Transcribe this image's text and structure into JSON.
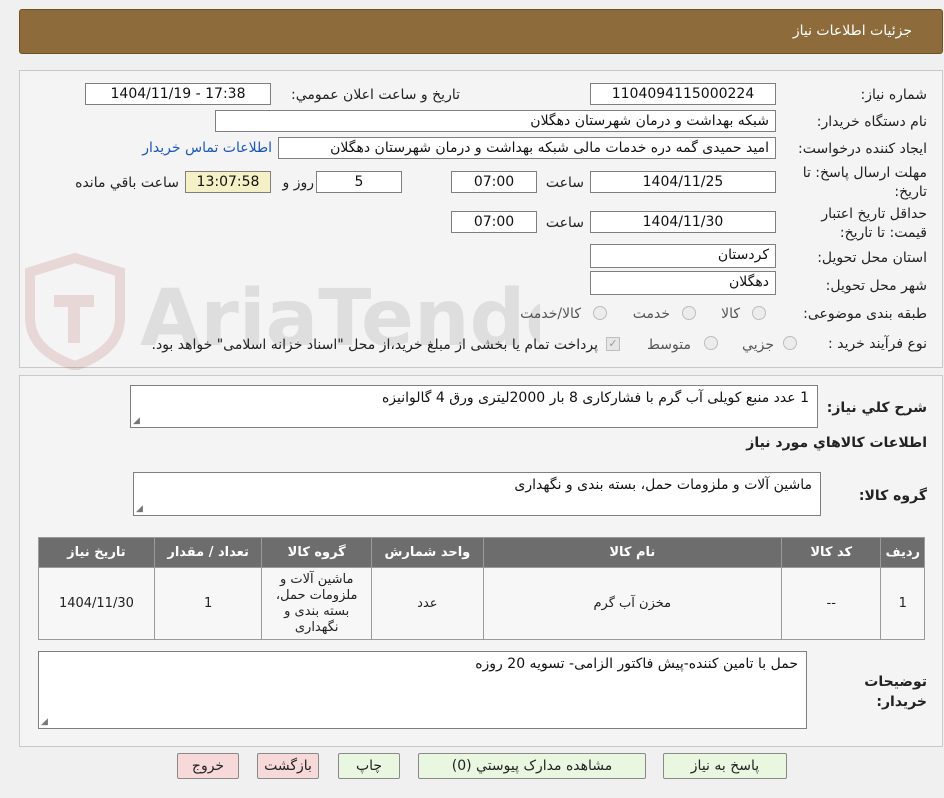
{
  "header": {
    "title": "جزئیات اطلاعات نیاز"
  },
  "watermark": {
    "text": "AriaTender.neT"
  },
  "form": {
    "need_number_label": "شماره نیاز:",
    "need_number": "1104094115000224",
    "announce_label": "تاریخ و ساعت اعلان عمومي:",
    "announce_value": "1404/11/19 - 17:38",
    "buyer_label": "نام دستگاه خريدار:",
    "buyer_value": "شبکه بهداشت و درمان شهرستان دهگلان",
    "creator_label": "ايجاد کننده درخواست:",
    "creator_value": "امید حمیدی گمه دره خدمات مالی شبکه بهداشت و درمان شهرستان دهگلان",
    "contact_link": "اطلاعات تماس خريدار",
    "deadline_label": "مهلت ارسال پاسخ: تا تاريخ:",
    "deadline_date": "1404/11/25",
    "time_label": "ساعت",
    "deadline_time": "07:00",
    "days_value": "5",
    "days_label": "روز و",
    "remaining_time": "13:07:58",
    "remaining_label": "ساعت باقي مانده",
    "validity_label": "حداقل تاريخ اعتبار قيمت: تا تاريخ:",
    "validity_date": "1404/11/30",
    "validity_time": "07:00",
    "province_label": "استان محل تحويل:",
    "province_value": "کردستان",
    "city_label": "شهر محل تحويل:",
    "city_value": "دهگلان",
    "category_label": "طبقه بندی موضوعی:",
    "category_options": [
      "کالا",
      "خدمت",
      "کالا/خدمت"
    ],
    "process_label": "نوع فرآيند خريد :",
    "process_options": [
      "جزیي",
      "متوسط"
    ],
    "payment_note": "پرداخت تمام يا بخشی از مبلغ خريد،از محل \"اسناد خزانه اسلامی\" خواهد بود."
  },
  "details": {
    "summary_label": "شرح کلي نياز:",
    "summary_value": "1 عدد منبع کویلی آب گرم با فشارکاری 8 بار 2000لیتری ورق 4 گالوانیزه",
    "goods_info_label": "اطلاعات کالاهاي مورد نياز",
    "goods_group_label": "گروه کالا:",
    "goods_group_value": "ماشین آلات و ملزومات حمل، بسته بندی و نگهداری",
    "table": {
      "headers": [
        "رديف",
        "کد کالا",
        "نام کالا",
        "واحد شمارش",
        "گروه کالا",
        "تعداد / مقدار",
        "تاريخ نياز"
      ],
      "rows": [
        [
          "1",
          "--",
          "مخزن آب گرم",
          "عدد",
          "ماشین آلات و ملزومات حمل، بسته بندی و نگهداری",
          "1",
          "1404/11/30"
        ]
      ]
    },
    "buyer_notes_label": "توضيحات خريدار:",
    "buyer_notes_value": "حمل با تامین کننده-پیش فاکتور الزامی- تسویه 20 روزه"
  },
  "buttons": {
    "reply": "پاسخ به نياز",
    "attachments": "مشاهده مدارک پيوستي (0)",
    "print": "چاپ",
    "back": "بازگشت",
    "exit": "خروج"
  }
}
